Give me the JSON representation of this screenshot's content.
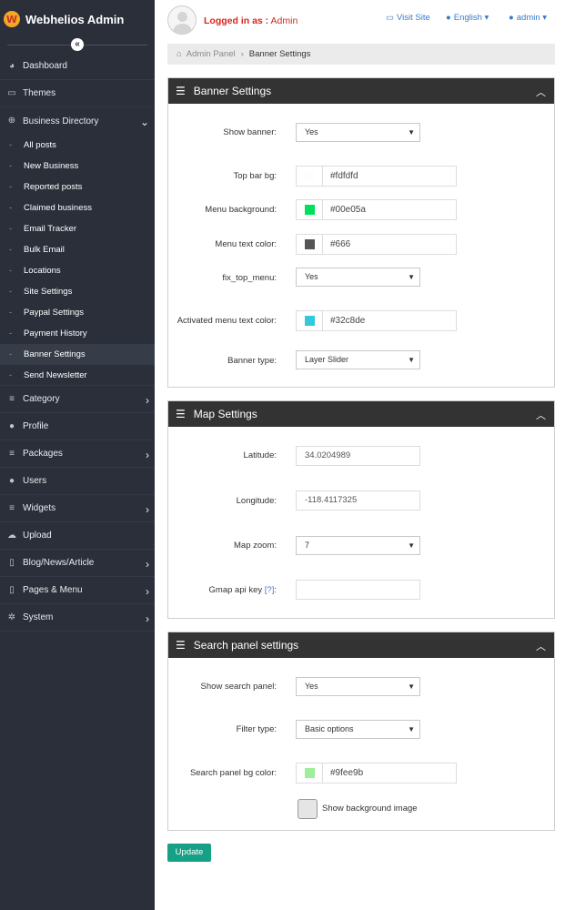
{
  "app": {
    "title": "Webhelios Admin"
  },
  "sidebar": {
    "items": [
      {
        "label": "Dashboard",
        "icon": "dashboard-icon"
      },
      {
        "label": "Themes",
        "icon": "monitor-icon"
      },
      {
        "label": "Business Directory",
        "icon": "plus-circle-icon"
      }
    ],
    "sub_items": [
      "All posts",
      "New Business",
      "Reported posts",
      "Claimed business",
      "Email Tracker",
      "Bulk Email",
      "Locations",
      "Site Settings",
      "Paypal Settings",
      "Payment History",
      "Banner Settings",
      "Send Newsletter"
    ],
    "lower_items": [
      {
        "label": "Category",
        "icon": "bars-icon"
      },
      {
        "label": "Profile",
        "icon": "user-icon"
      },
      {
        "label": "Packages",
        "icon": "bars-icon"
      },
      {
        "label": "Users",
        "icon": "users-icon"
      },
      {
        "label": "Widgets",
        "icon": "bars-icon"
      },
      {
        "label": "Upload",
        "icon": "cloud-upload-icon"
      },
      {
        "label": "Blog/News/Article",
        "icon": "file-icon"
      },
      {
        "label": "Pages & Menu",
        "icon": "file-icon"
      },
      {
        "label": "System",
        "icon": "gear-icon"
      }
    ]
  },
  "header": {
    "logged_label": "Logged in as :",
    "logged_user": "Admin",
    "visit_site": "Visit Site",
    "language": "English",
    "user_menu": "admin"
  },
  "breadcrumb": {
    "root": "Admin Panel",
    "current": "Banner Settings"
  },
  "banner": {
    "title": "Banner Settings",
    "show_banner_label": "Show banner:",
    "show_banner_value": "Yes",
    "top_bar_bg_label": "Top bar bg:",
    "top_bar_bg_value": "#fdfdfd",
    "menu_bg_label": "Menu background:",
    "menu_bg_value": "#00e05a",
    "menu_text_label": "Menu text color:",
    "menu_text_value": "#666",
    "fix_top_label": "fix_top_menu:",
    "fix_top_value": "Yes",
    "active_menu_label": "Activated menu text color:",
    "active_menu_value": "#32c8de",
    "banner_type_label": "Banner type:",
    "banner_type_value": "Layer Slider"
  },
  "map": {
    "title": "Map Settings",
    "latitude_label": "Latitude:",
    "latitude_value": "34.0204989",
    "longitude_label": "Longitude:",
    "longitude_value": "-118.4117325",
    "zoom_label": "Map zoom:",
    "zoom_value": "7",
    "gmap_label": "Gmap api key",
    "gmap_help": "[?]",
    "gmap_colon": ":",
    "gmap_value": ""
  },
  "search": {
    "title": "Search panel settings",
    "show_label": "Show search panel:",
    "show_value": "Yes",
    "filter_label": "Filter type:",
    "filter_value": "Basic options",
    "bg_label": "Search panel bg color:",
    "bg_value": "#9fee9b",
    "bg_image_label": "Show background image"
  },
  "actions": {
    "update": "Update"
  },
  "colors": {
    "sidebar_bg": "#2a2f3a",
    "panel_head": "#333333",
    "accent": "#16a085",
    "logged_red": "#d9251c",
    "link": "#3a7bc8"
  }
}
